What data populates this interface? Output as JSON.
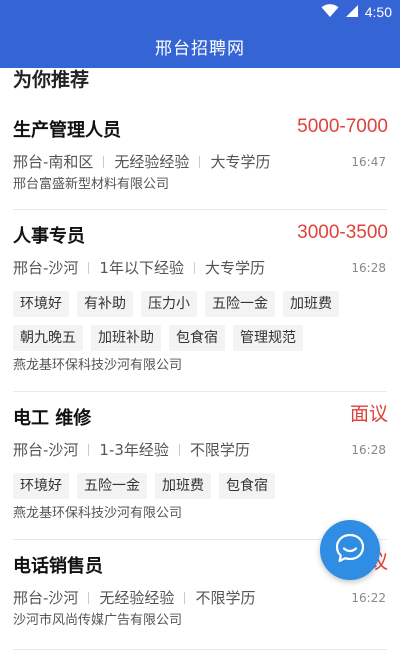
{
  "status_bar": {
    "time": "4:50",
    "icons": [
      "wifi-icon",
      "signal-icon"
    ]
  },
  "app_bar": {
    "title": "邢台招聘网"
  },
  "section": {
    "title": "为你推荐"
  },
  "jobs": [
    {
      "title": "生产管理人员",
      "salary": "5000-7000",
      "location": "邢台-南和区",
      "experience": "无经验经验",
      "education": "大专学历",
      "time": "16:47",
      "tags": [],
      "company": "邢台富盛新型材料有限公司"
    },
    {
      "title": "人事专员",
      "salary": "3000-3500",
      "location": "邢台-沙河",
      "experience": "1年以下经验",
      "education": "大专学历",
      "time": "16:28",
      "tags": [
        "环境好",
        "有补助",
        "压力小",
        "五险一金",
        "加班费",
        "朝九晚五",
        "加班补助",
        "包食宿",
        "管理规范"
      ],
      "company": "燕龙基环保科技沙河有限公司"
    },
    {
      "title": "电工 维修",
      "salary": "面议",
      "location": "邢台-沙河",
      "experience": "1-3年经验",
      "education": "不限学历",
      "time": "16:28",
      "tags": [
        "环境好",
        "五险一金",
        "加班费",
        "包食宿"
      ],
      "company": "燕龙基环保科技沙河有限公司"
    },
    {
      "title": "电话销售员",
      "salary": "面议",
      "location": "邢台-沙河",
      "experience": "无经验经验",
      "education": "不限学历",
      "time": "16:22",
      "tags": [],
      "company": "沙河市风尚传媒广告有限公司"
    }
  ],
  "colors": {
    "primary": "#3565d4",
    "salary": "#e0423a",
    "fab": "#2f8de4"
  }
}
